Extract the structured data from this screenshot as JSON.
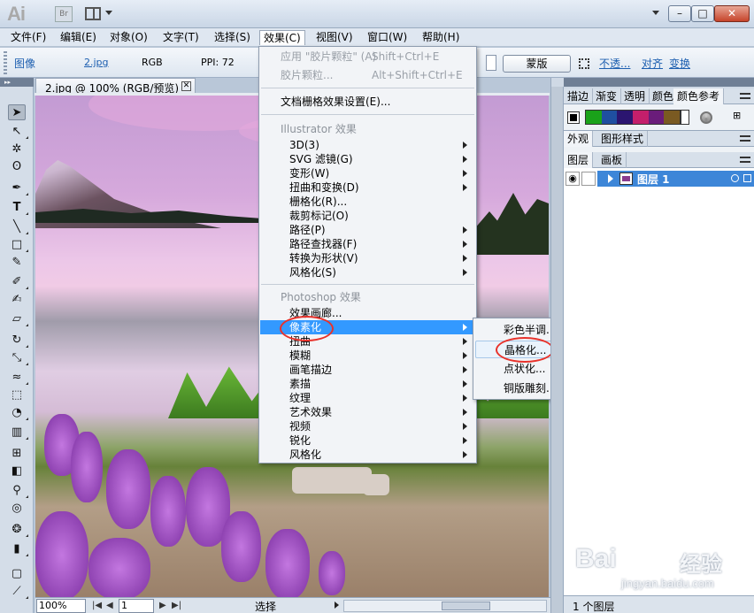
{
  "titlebar": {
    "app_logo": "Ai",
    "bridge_label": "Br",
    "min": "–",
    "max": "□",
    "close": "✕"
  },
  "menubar": {
    "items": [
      "文件(F)",
      "编辑(E)",
      "对象(O)",
      "文字(T)",
      "选择(S)",
      "效果(C)",
      "视图(V)",
      "窗口(W)",
      "帮助(H)"
    ],
    "active": "效果(C)"
  },
  "controlbar": {
    "image_label": "图像",
    "file_name": "2.jpg",
    "color_mode": "RGB",
    "ppi": "PPI: 72",
    "mask_button": "蒙版",
    "opacity_link": "不透...",
    "align_link": "对齐",
    "transform_link": "变换"
  },
  "document": {
    "tab_title": "2.jpg @ 100% (RGB/预览)",
    "tab_close": "✕"
  },
  "effect_menu": {
    "apply_last": {
      "label": "应用 \"胶片颗粒\" (A)",
      "shortcut": "Shift+Ctrl+E"
    },
    "last_effect": {
      "label": "胶片颗粒...",
      "shortcut": "Alt+Shift+Ctrl+E"
    },
    "doc_raster_settings": "文档栅格效果设置(E)...",
    "illustrator_header": "Illustrator 效果",
    "illustrator_items": [
      {
        "label": "3D(3)",
        "submenu": true
      },
      {
        "label": "SVG 滤镜(G)",
        "submenu": true
      },
      {
        "label": "变形(W)",
        "submenu": true
      },
      {
        "label": "扭曲和变换(D)",
        "submenu": true
      },
      {
        "label": "栅格化(R)...",
        "submenu": false
      },
      {
        "label": "裁剪标记(O)",
        "submenu": false
      },
      {
        "label": "路径(P)",
        "submenu": true
      },
      {
        "label": "路径查找器(F)",
        "submenu": true
      },
      {
        "label": "转换为形状(V)",
        "submenu": true
      },
      {
        "label": "风格化(S)",
        "submenu": true
      }
    ],
    "photoshop_header": "Photoshop 效果",
    "photoshop_items": [
      {
        "label": "效果画廊...",
        "submenu": false
      },
      {
        "label": "像素化",
        "submenu": true,
        "highlighted": true
      },
      {
        "label": "扭曲",
        "submenu": true
      },
      {
        "label": "模糊",
        "submenu": true
      },
      {
        "label": "画笔描边",
        "submenu": true
      },
      {
        "label": "素描",
        "submenu": true
      },
      {
        "label": "纹理",
        "submenu": true
      },
      {
        "label": "艺术效果",
        "submenu": true
      },
      {
        "label": "视频",
        "submenu": true
      },
      {
        "label": "锐化",
        "submenu": true
      },
      {
        "label": "风格化",
        "submenu": true
      }
    ]
  },
  "pixelate_submenu": {
    "items": [
      "彩色半调...",
      "晶格化...",
      "点状化...",
      "铜版雕刻..."
    ],
    "hovered": "晶格化..."
  },
  "panels": {
    "group1_tabs": [
      "描边",
      "渐变",
      "透明",
      "颜色",
      "颜色参考"
    ],
    "group1_active": "颜色参考",
    "harmony_colors": [
      "#1aa21a",
      "#1f4fa0",
      "#2b1570",
      "#c41f6b",
      "#6a1c7a",
      "#7a5a22"
    ],
    "group2_tabs": [
      "外观",
      "图形样式"
    ],
    "group2_active": "外观",
    "group3_tabs": [
      "图层",
      "画板"
    ],
    "group3_active": "图层",
    "layer_name": "图层 1",
    "layers_count": "1 个图层"
  },
  "statusbar": {
    "zoom": "100%",
    "page": "1",
    "status": "选择"
  },
  "watermark": {
    "brand": "Bai",
    "jingyan": "经验",
    "sub": "jingyan.baidu.com"
  },
  "colors": {
    "menu_highlight": "#3399ff",
    "annotation_red": "#e8322b",
    "layer_selected": "#3d86d8"
  }
}
